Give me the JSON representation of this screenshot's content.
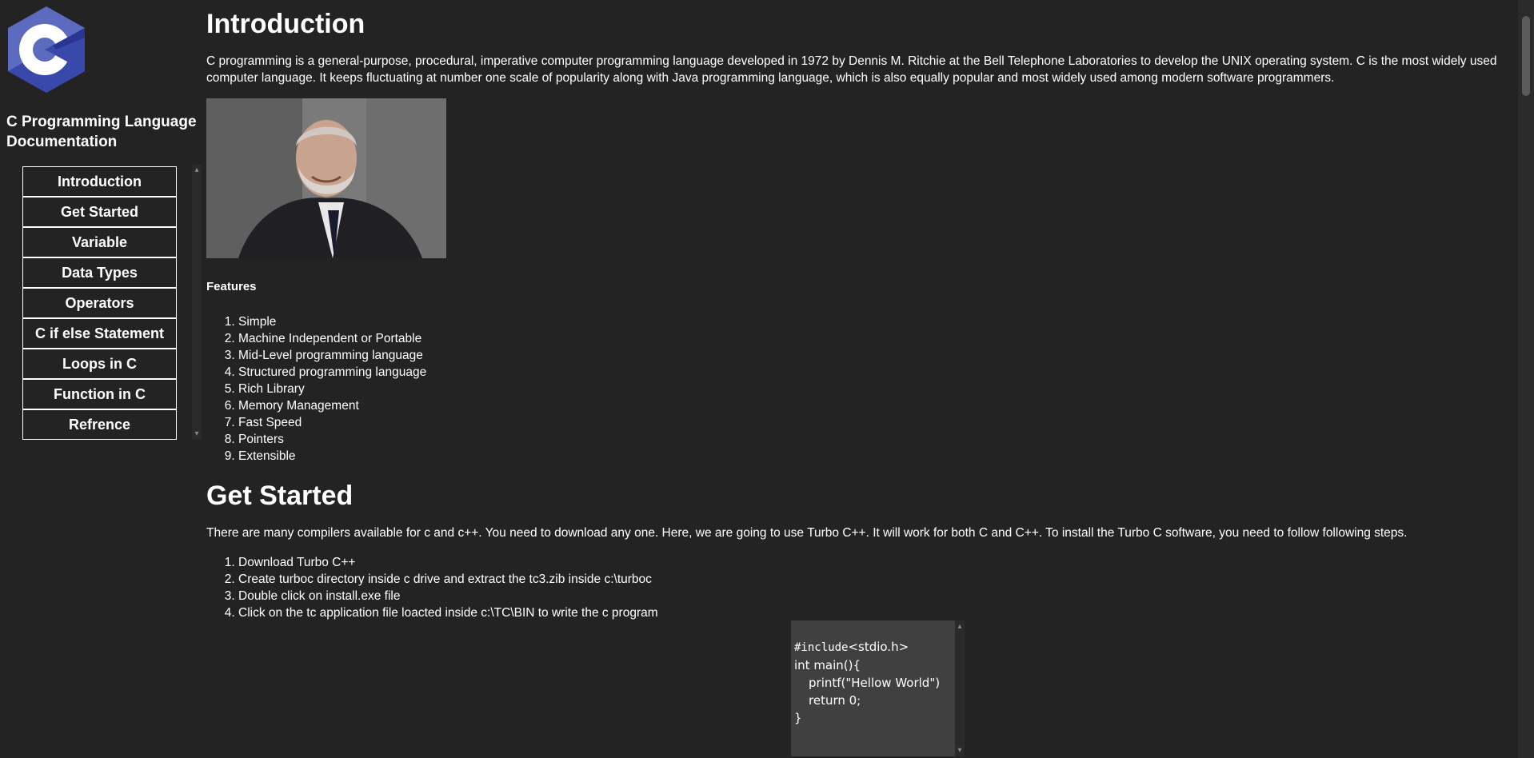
{
  "colors": {
    "background": "#232323",
    "text": "#ffffff",
    "code_bg": "#404040",
    "logo_dark": "#3a4a9e",
    "logo_light": "#5c6bc0"
  },
  "sidebar": {
    "title": "C Programming Language Documentation",
    "logo_icon": "c-language-logo",
    "nav": [
      {
        "label": "Introduction"
      },
      {
        "label": "Get Started"
      },
      {
        "label": "Variable"
      },
      {
        "label": "Data Types"
      },
      {
        "label": "Operators"
      },
      {
        "label": "C if else Statement"
      },
      {
        "label": "Loops in C"
      },
      {
        "label": "Function in C"
      },
      {
        "label": "Refrence"
      }
    ]
  },
  "intro": {
    "heading": "Introduction",
    "paragraph": "C programming is a general-purpose, procedural, imperative computer programming language developed in 1972 by Dennis M. Ritchie at the Bell Telephone Laboratories to develop the UNIX operating system. C is the most widely used computer language. It keeps fluctuating at number one scale of popularity along with Java programming language, which is also equally popular and most widely used among modern software programmers.",
    "features_label": "Features",
    "features": [
      "Simple",
      "Machine Independent or Portable",
      "Mid-Level programming language",
      "Structured programming language",
      "Rich Library",
      "Memory Management",
      "Fast Speed",
      "Pointers",
      "Extensible"
    ]
  },
  "get_started": {
    "heading": "Get Started",
    "paragraph": "There are many compilers available for c and c++. You need to download any one. Here, we are going to use Turbo C++. It will work for both C and C++. To install the Turbo C software, you need to follow following steps.",
    "steps": [
      "Download Turbo C++",
      "Create turboc directory inside c drive and extract the tc3.zib inside c:\\turboc",
      "Double click on install.exe file",
      "Click on the tc application file loacted inside c:\\TC\\BIN to write the c program"
    ],
    "code": {
      "include_kw": "#include",
      "include_rest": "<stdio.h>",
      "line2": "int main(){",
      "line3": "printf(\"Hellow World\")",
      "line4": "return 0;",
      "line5": "}"
    }
  }
}
